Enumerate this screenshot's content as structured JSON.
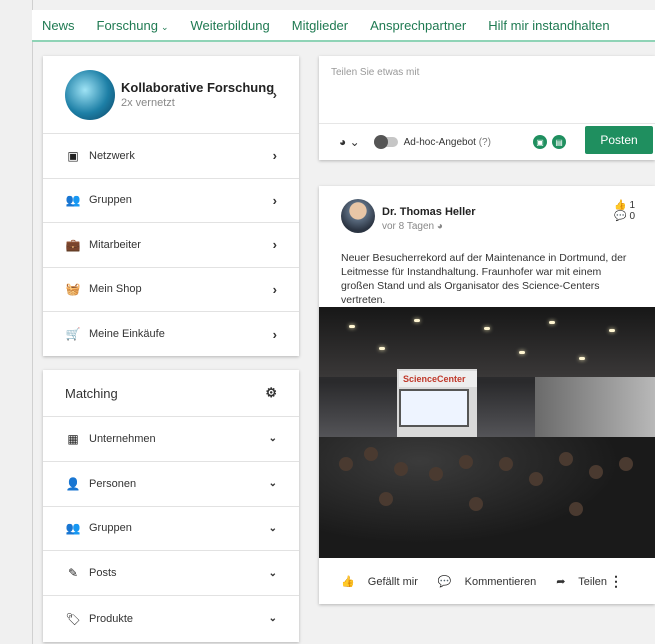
{
  "nav": {
    "items": [
      "News",
      "Forschung",
      "Weiterbildung",
      "Mitglieder",
      "Ansprechpartner",
      "Hilf mir instandhalten"
    ]
  },
  "profile": {
    "title": "Kollaborative Forschung",
    "subtitle": "2x vernetzt"
  },
  "menu": [
    {
      "label": "Netzwerk",
      "icon": "address-book-icon",
      "glyph": "▣"
    },
    {
      "label": "Gruppen",
      "icon": "group-icon",
      "glyph": "👥"
    },
    {
      "label": "Mitarbeiter",
      "icon": "briefcase-icon",
      "glyph": "💼"
    },
    {
      "label": "Mein Shop",
      "icon": "shop-icon",
      "glyph": "🧺"
    },
    {
      "label": "Meine Einkäufe",
      "icon": "cart-icon",
      "glyph": "🛒"
    }
  ],
  "matching": {
    "title": "Matching",
    "items": [
      {
        "label": "Unternehmen",
        "icon": "building-icon",
        "glyph": "▦"
      },
      {
        "label": "Personen",
        "icon": "person-icon",
        "glyph": "👤"
      },
      {
        "label": "Gruppen",
        "icon": "group-icon",
        "glyph": "👥"
      },
      {
        "label": "Posts",
        "icon": "edit-icon",
        "glyph": "✎"
      },
      {
        "label": "Produkte",
        "icon": "tag-icon",
        "glyph": "🏷"
      }
    ]
  },
  "composer": {
    "placeholder": "Teilen Sie etwas mit",
    "adhoc_label": "Ad-hoc-Angebot",
    "adhoc_hint": "(?)",
    "post_button": "Posten"
  },
  "post": {
    "author": "Dr. Thomas Heller",
    "time": "vor 8 Tagen",
    "likes": "1",
    "comments": "0",
    "text": "Neuer Besucherrekord auf der Maintenance in Dortmund, der Leitmesse für Instandhaltung. Fraunhofer war mit einem großen Stand und als Organisator des Science-Centers vertreten.",
    "image_sign": "ScienceCenter",
    "actions": {
      "like": "Gefällt mir",
      "comment": "Kommentieren",
      "share": "Teilen"
    }
  },
  "colors": {
    "accent": "#1f8f5f",
    "nav_text": "#1f7a52"
  }
}
